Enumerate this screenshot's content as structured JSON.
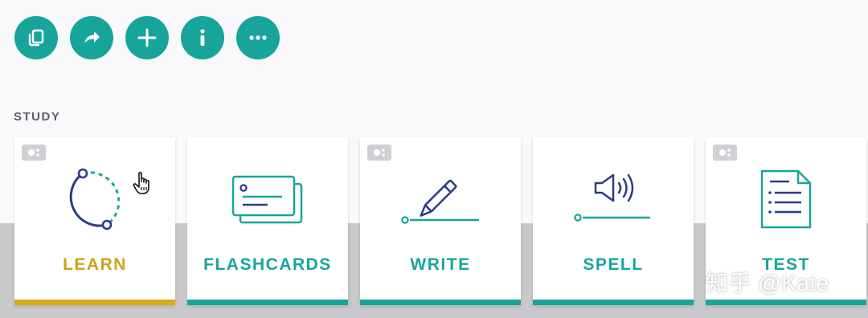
{
  "toolbar": {
    "buttons": [
      {
        "icon": "copy-icon"
      },
      {
        "icon": "share-icon"
      },
      {
        "icon": "plus-icon"
      },
      {
        "icon": "info-icon"
      },
      {
        "icon": "more-icon"
      }
    ]
  },
  "study": {
    "label": "STUDY",
    "cards": [
      {
        "label": "LEARN",
        "icon": "learn-icon",
        "accent": "#dcaa16",
        "badge": true
      },
      {
        "label": "FLASHCARDS",
        "icon": "flashcards-icon",
        "accent": "#17a59b",
        "badge": false
      },
      {
        "label": "WRITE",
        "icon": "pencil-icon",
        "accent": "#17a59b",
        "badge": true
      },
      {
        "label": "SPELL",
        "icon": "speaker-icon",
        "accent": "#17a59b",
        "badge": false
      },
      {
        "label": "TEST",
        "icon": "test-document-icon",
        "accent": "#17a59b",
        "badge": true
      }
    ]
  },
  "watermark": "知乎 @Kate",
  "colors": {
    "teal": "#17a59b",
    "gold": "#dcaa16",
    "navy": "#2e3a87"
  }
}
